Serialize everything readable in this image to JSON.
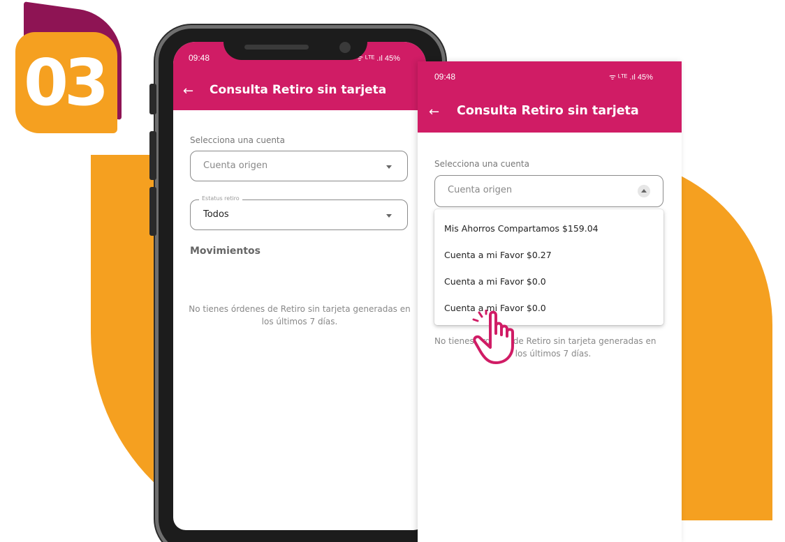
{
  "step_badge": "03",
  "colors": {
    "brand_pink": "#D01C65",
    "accent_orange": "#F5A020",
    "badge_back": "#8E1454"
  },
  "back_screen": {
    "status": {
      "time": "09:48",
      "right": "ᯤ ᴸᵀᴱ .ıl 45%"
    },
    "appbar": {
      "back_icon": "arrow-left-icon",
      "title": "Consulta Retiro sin tarjeta"
    },
    "account_label": "Selecciona una cuenta",
    "account_placeholder": "Cuenta origen",
    "status_filter": {
      "legend": "Estatus retiro",
      "value": "Todos"
    },
    "section_title": "Movimientos",
    "empty_message": "No tienes órdenes de Retiro sin tarjeta generadas en los últimos 7 días."
  },
  "front_screen": {
    "status": {
      "time": "09:48",
      "right": "ᯤ ᴸᵀᴱ .ıl 45%"
    },
    "appbar": {
      "back_icon": "arrow-left-icon",
      "title": "Consulta Retiro sin tarjeta"
    },
    "account_label": "Selecciona una cuenta",
    "account_placeholder": "Cuenta origen",
    "dropdown_options": [
      "Mis Ahorros Compartamos $159.04",
      "Cuenta a mi Favor $0.27",
      "Cuenta a mi Favor $0.0",
      "Cuenta a mi Favor $0.0"
    ],
    "empty_message_line1": "No tienes órdenes de Retiro sin tarjeta generadas en",
    "empty_message_line2": "los últimos 7 días."
  }
}
